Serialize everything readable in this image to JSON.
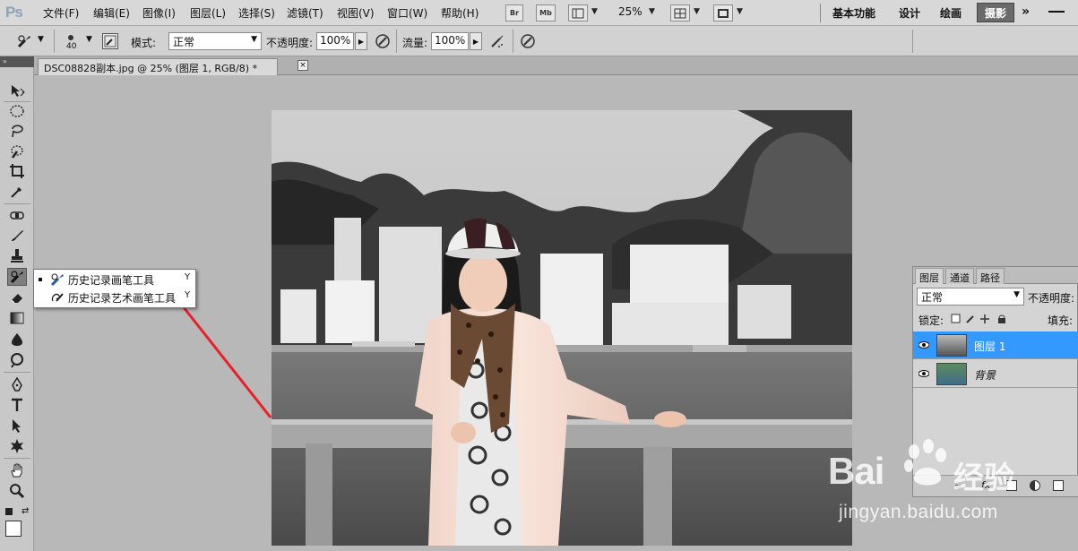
{
  "menubar": {
    "app_logo": "Ps",
    "items": [
      "文件(F)",
      "编辑(E)",
      "图像(I)",
      "图层(L)",
      "选择(S)",
      "滤镜(T)",
      "视图(V)",
      "窗口(W)",
      "帮助(H)"
    ],
    "bridge_label": "Br",
    "minibridge_label": "Mb",
    "zoom": "25%",
    "workspaces": [
      "基本功能",
      "设计",
      "绘画"
    ],
    "active_workspace": "摄影",
    "more": "»"
  },
  "options": {
    "brush_size": "40",
    "mode_label": "模式:",
    "mode_value": "正常",
    "opacity_label": "不透明度:",
    "opacity_value": "100%",
    "flow_label": "流量:",
    "flow_value": "100%"
  },
  "document": {
    "tab_title": "DSC08828副本.jpg @ 25% (图层 1, RGB/8) *",
    "close": "×"
  },
  "flyout": {
    "items": [
      {
        "label": "历史记录画笔工具",
        "key": "Y",
        "selected": true
      },
      {
        "label": "历史记录艺术画笔工具",
        "key": "Y",
        "selected": false
      }
    ]
  },
  "layers_panel": {
    "tabs": [
      "图层",
      "通道",
      "路径"
    ],
    "blend_mode": "正常",
    "opacity_label": "不透明度:",
    "lock_label": "锁定:",
    "fill_label": "填充:",
    "layers": [
      {
        "name": "图层 1",
        "selected": true
      },
      {
        "name": "背景",
        "selected": false
      }
    ]
  },
  "watermark": {
    "brand": "Bai",
    "brand_cn": "经验",
    "url": "jingyan.baidu.com"
  },
  "colors": {
    "accent_selection": "#3399ff",
    "annotation_arrow": "#e8202a"
  }
}
